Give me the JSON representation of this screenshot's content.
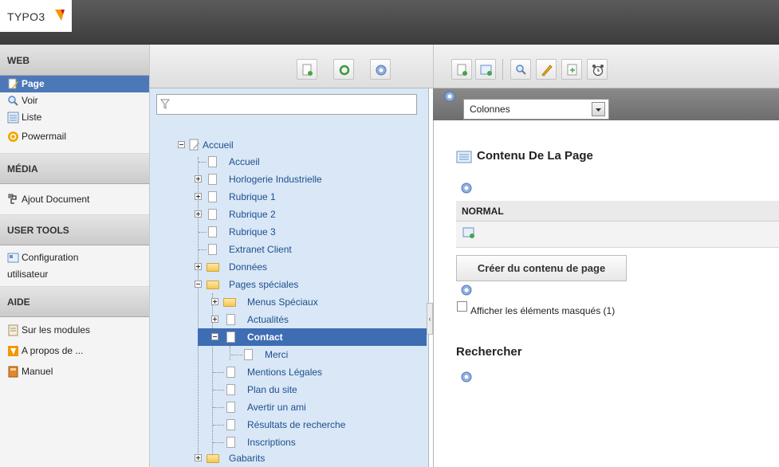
{
  "brand": {
    "name": "TYPO3"
  },
  "modules": {
    "web": {
      "title": "WEB",
      "items": [
        {
          "label": "Page",
          "icon": "page-pencil-icon",
          "active": true
        },
        {
          "label": "Voir",
          "icon": "magnifier-icon"
        },
        {
          "label": "Liste",
          "icon": "list-icon"
        },
        {
          "label": "Powermail",
          "icon": "powermail-icon"
        }
      ]
    },
    "media": {
      "title": "MÉDIA",
      "items": [
        {
          "label": "Ajout Document",
          "icon": "add-document-icon"
        }
      ]
    },
    "user_tools": {
      "title": "USER TOOLS",
      "items": [
        {
          "label_line1": "Configuration",
          "label_line2": "utilisateur",
          "icon": "user-config-icon"
        }
      ]
    },
    "aide": {
      "title": "AIDE",
      "items": [
        {
          "label": "Sur les modules",
          "icon": "modules-help-icon"
        },
        {
          "label": "A propos de ...",
          "icon": "typo3-icon"
        },
        {
          "label": "Manuel",
          "icon": "manual-icon"
        }
      ]
    }
  },
  "filter": {
    "placeholder": ""
  },
  "tree": {
    "root": "Accueil",
    "items": [
      "Accueil",
      "Horlogerie Industrielle",
      "Rubrique 1",
      "Rubrique 2",
      "Rubrique 3",
      "Extranet Client",
      "Données",
      "Pages spéciales",
      "Menus Spéciaux",
      "Actualités",
      "Contact",
      "Merci",
      "Mentions Légales",
      "Plan du site",
      "Avertir un ami",
      "Résultats de recherche",
      "Inscriptions",
      "Gabarits"
    ],
    "selected": "Contact"
  },
  "content": {
    "column_select": "Colonnes",
    "title": "Contenu De La Page",
    "column_normal": "NORMAL",
    "create_button": "Créer du contenu de page",
    "show_hidden": "Afficher les éléments masqués (1)",
    "search_title": "Rechercher"
  },
  "colors": {
    "accent": "#4d78b8",
    "tree_bg": "#d9e7f7",
    "selected": "#3e6db3",
    "topbar": "#3c3c3c"
  }
}
